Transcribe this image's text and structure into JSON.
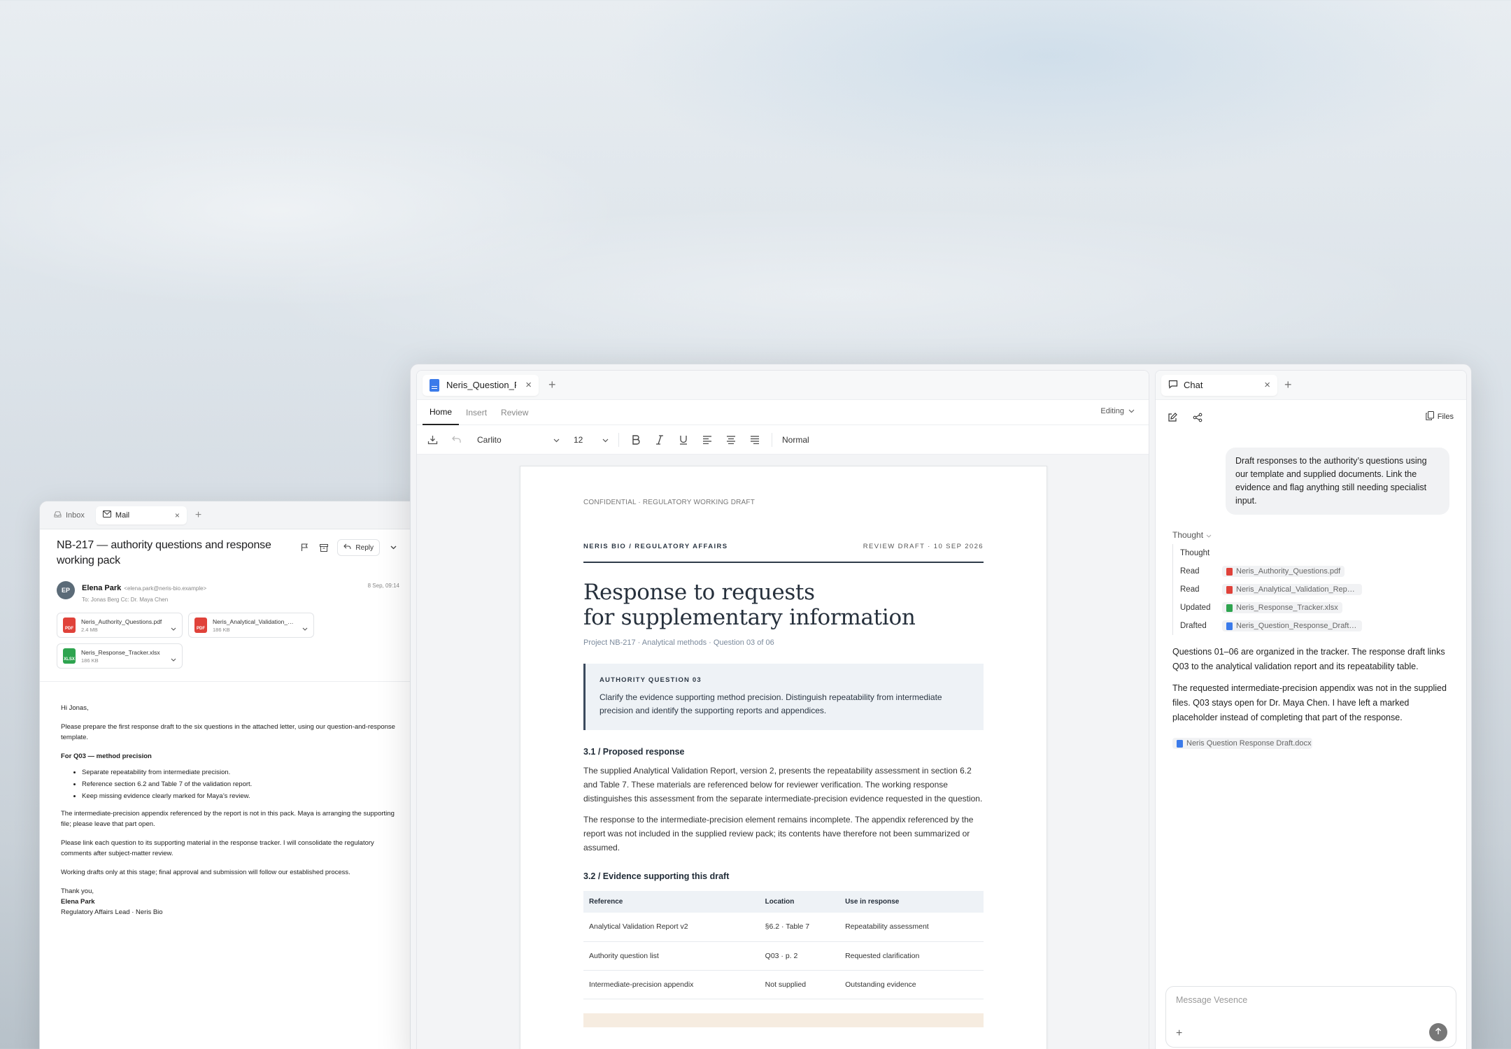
{
  "mail": {
    "tabs": [
      {
        "label": "Inbox",
        "icon": "inbox-icon"
      },
      {
        "label": "Mail",
        "icon": "mail-icon"
      }
    ],
    "subject": "NB-217 — authority questions and response working pack",
    "reply_label": "Reply",
    "sender": {
      "initials": "EP",
      "name": "Elena Park",
      "email": "<elena.park@neris-bio.example>",
      "to": "To: Jonas Berg    Cc: Dr. Maya Chen",
      "date": "8 Sep, 09:14"
    },
    "attachments": [
      {
        "name": "Neris_Authority_Questions.pdf",
        "size": "2.4 MB",
        "type": "PDF"
      },
      {
        "name": "Neris_Analytical_Validation_Report.pdf",
        "size": "186 KB",
        "type": "PDF"
      },
      {
        "name": "Neris_Response_Tracker.xlsx",
        "size": "186 KB",
        "type": "XLSX"
      }
    ],
    "body": {
      "greeting": "Hi Jonas,",
      "p1": "Please prepare the first response draft to the six questions in the attached letter, using our question-and-response template.",
      "q03_heading": "For Q03 — method precision",
      "bullets": [
        "Separate repeatability from intermediate precision.",
        "Reference section 6.2 and Table 7 of the validation report.",
        "Keep missing evidence clearly marked for Maya’s review."
      ],
      "p2": "The intermediate-precision appendix referenced by the report is not in this pack. Maya is arranging the supporting file; please leave that part open.",
      "p3": "Please link each question to its supporting material in the response tracker. I will consolidate the regulatory comments after subject-matter review.",
      "p4": "Working drafts only at this stage; final approval and submission will follow our established process.",
      "signoff": "Thank you,",
      "sig_name": "Elena Park",
      "sig_title": "Regulatory Affairs Lead · Neris Bio"
    }
  },
  "editor": {
    "tab_name": "Neris_Question_Response_Draft.docx",
    "ribbon_tabs": [
      "Home",
      "Insert",
      "Review"
    ],
    "mode": "Editing",
    "font": "Carlito",
    "size": "12",
    "style": "Normal",
    "doc": {
      "confidential": "CONFIDENTIAL · REGULATORY WORKING DRAFT",
      "running_left": "NERIS BIO / REGULATORY AFFAIRS",
      "running_right": "REVIEW DRAFT · 10 SEP 2026",
      "title_line1": "Response to requests",
      "title_line2": "for supplementary information",
      "subtitle": "Project NB-217 · Analytical methods · Question 03 of 06",
      "question_label": "AUTHORITY QUESTION 03",
      "question_text": "Clarify the evidence supporting method precision. Distinguish repeatability from intermediate precision and identify the supporting reports and appendices.",
      "sec1": "3.1 / Proposed response",
      "sec1_p1": "The supplied Analytical Validation Report, version 2, presents the repeatability assessment in section 6.2 and Table 7. These materials are referenced below for reviewer verification. The working response distinguishes this assessment from the separate intermediate-precision evidence requested in the question.",
      "sec1_p2": "The response to the intermediate-precision element remains incomplete. The appendix referenced by the report was not included in the supplied review pack; its contents have therefore not been summarized or assumed.",
      "sec2": "3.2 / Evidence supporting this draft",
      "table_headers": [
        "Reference",
        "Location",
        "Use in response"
      ],
      "table_rows": [
        [
          "Analytical Validation Report v2",
          "§6.2 · Table 7",
          "Repeatability assessment"
        ],
        [
          "Authority question list",
          "Q03 · p. 2",
          "Requested clarification"
        ],
        [
          "Intermediate-precision appendix",
          "Not supplied",
          "Outstanding evidence"
        ]
      ]
    }
  },
  "chat": {
    "tab_label": "Chat",
    "files_label": "Files",
    "user_message": "Draft responses to the authority’s questions using our template and supplied documents. Link the evidence and flag anything still needing specialist input.",
    "thought_label": "Thought",
    "steps": [
      {
        "label": "Thought",
        "file": "",
        "type": ""
      },
      {
        "label": "Read",
        "file": "Neris_Authority_Questions.pdf",
        "type": "pdf"
      },
      {
        "label": "Read",
        "file": "Neris_Analytical_Validation_Report.pdf",
        "type": "pdf"
      },
      {
        "label": "Updated",
        "file": "Neris_Response_Tracker.xlsx",
        "type": "xls"
      },
      {
        "label": "Drafted",
        "file": "Neris_Question_Response_Draft.docx",
        "type": "doc"
      }
    ],
    "reply_p1": "Questions 01–06 are organized in the tracker. The response draft links Q03 to the analytical validation report and its repeatability table.",
    "reply_p2": "The requested intermediate-precision appendix was not in the supplied files. Q03 stays open for Dr. Maya Chen. I have left a marked placeholder instead of completing that part of the response.",
    "output_file": "Neris Question Response Draft.docx",
    "composer_placeholder": "Message Vesence"
  }
}
